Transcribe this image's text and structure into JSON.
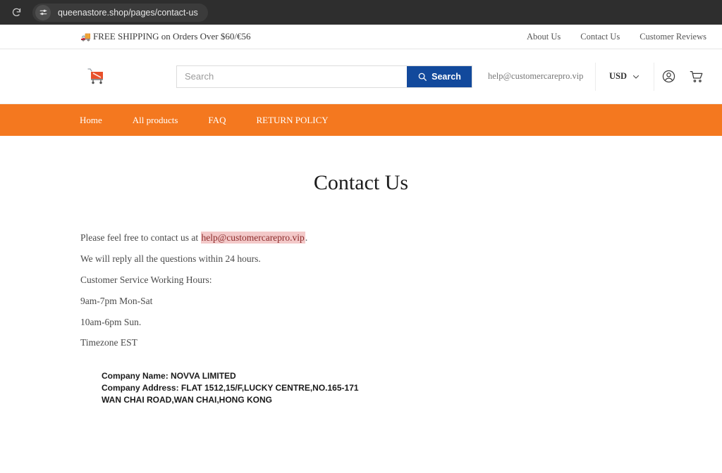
{
  "browser": {
    "url": "queenastore.shop/pages/contact-us",
    "reload_icon": "reload-icon",
    "tune_icon": "page-settings-icon"
  },
  "promo": {
    "emoji": "🚚",
    "text": "FREE SHIPPING on Orders Over $60/€56",
    "links": [
      {
        "label": "About Us"
      },
      {
        "label": "Contact Us"
      },
      {
        "label": "Customer Reviews"
      }
    ]
  },
  "header": {
    "logo_icon": "shopping-cart-logo",
    "search": {
      "placeholder": "Search",
      "value": "",
      "button_label": "Search",
      "button_color": "#12499c",
      "search_icon": "search-icon"
    },
    "email": "help@customercarepro.vip",
    "currency": {
      "label": "USD",
      "chevron_icon": "chevron-down-icon"
    },
    "account_icon": "user-account-icon",
    "cart_icon": "cart-icon"
  },
  "nav": {
    "accent_color": "#f4781f",
    "items": [
      {
        "label": "Home"
      },
      {
        "label": "All products"
      },
      {
        "label": "FAQ"
      },
      {
        "label": "RETURN POLICY"
      }
    ]
  },
  "main": {
    "title": "Contact Us",
    "intro_before": "Please feel free to contact us at ",
    "intro_email": "help@customercarepro.vip",
    "intro_after": ".",
    "highlight_color": "#f3c9c9",
    "lines": [
      "We will reply all the questions within 24 hours.",
      "Customer Service Working Hours:",
      "9am-7pm Mon-Sat",
      "10am-6pm Sun.",
      "Timezone EST"
    ],
    "company": [
      "Company Name: NOVVA LIMITED",
      "Company Address: FLAT 1512,15/F,LUCKY CENTRE,NO.165-171",
      "WAN CHAI ROAD,WAN CHAI,HONG KONG"
    ]
  }
}
